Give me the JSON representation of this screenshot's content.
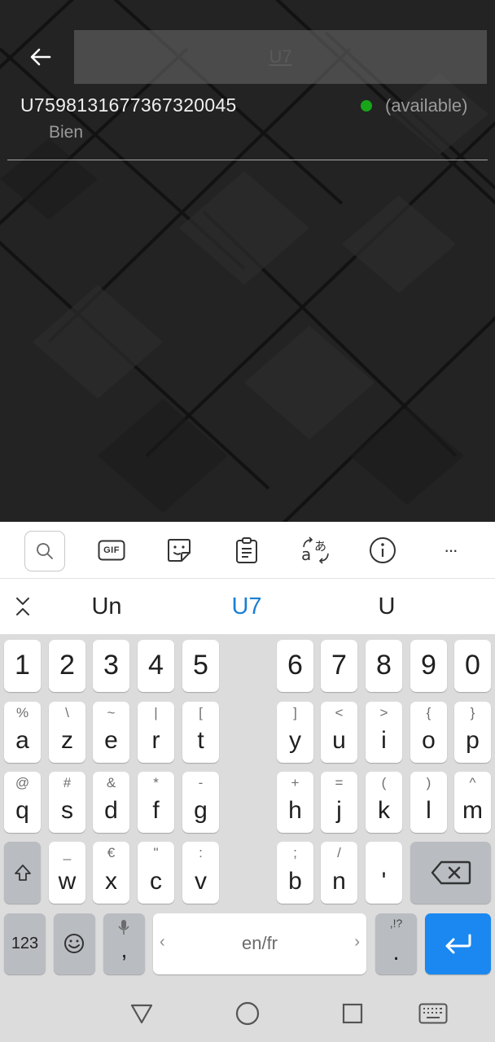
{
  "header": {
    "search_value": "U7"
  },
  "result": {
    "id": "U7598131677367320045",
    "subtitle": "Bien",
    "status": "(available)",
    "status_color": "#18a51a"
  },
  "toolbar": {
    "icons": [
      "search-icon",
      "gif-icon",
      "sticker-icon",
      "clipboard-icon",
      "translate-icon",
      "info-icon",
      "more-icon"
    ],
    "gif_label": "GIF",
    "more_label": "···"
  },
  "suggestions": {
    "items": [
      "Un",
      "U7",
      "U"
    ],
    "highlight_color": "#1a7fd4"
  },
  "keyboard": {
    "numbers": [
      "1",
      "2",
      "3",
      "4",
      "5",
      "6",
      "7",
      "8",
      "9",
      "0"
    ],
    "row1": [
      {
        "main": "a",
        "sub": "%"
      },
      {
        "main": "z",
        "sub": "\\"
      },
      {
        "main": "e",
        "sub": "~"
      },
      {
        "main": "r",
        "sub": "|"
      },
      {
        "main": "t",
        "sub": "["
      },
      {
        "main": "y",
        "sub": "]"
      },
      {
        "main": "u",
        "sub": "<"
      },
      {
        "main": "i",
        "sub": ">"
      },
      {
        "main": "o",
        "sub": "{"
      },
      {
        "main": "p",
        "sub": "}"
      }
    ],
    "row2": [
      {
        "main": "q",
        "sub": "@"
      },
      {
        "main": "s",
        "sub": "#"
      },
      {
        "main": "d",
        "sub": "&"
      },
      {
        "main": "f",
        "sub": "*"
      },
      {
        "main": "g",
        "sub": "-"
      },
      {
        "main": "h",
        "sub": "+"
      },
      {
        "main": "j",
        "sub": "="
      },
      {
        "main": "k",
        "sub": "("
      },
      {
        "main": "l",
        "sub": ")"
      },
      {
        "main": "m",
        "sub": "^"
      }
    ],
    "row3": [
      {
        "main": "w",
        "sub": "_"
      },
      {
        "main": "x",
        "sub": "€"
      },
      {
        "main": "c",
        "sub": "\""
      },
      {
        "main": "v",
        "sub": ":"
      },
      {
        "main": "b",
        "sub": ";"
      },
      {
        "main": "n",
        "sub": "/"
      },
      {
        "main": "'",
        "sub": ""
      }
    ],
    "num_toggle": "123",
    "comma": ",",
    "space_label": "en/fr",
    "period": ".",
    "period_sub": ",!?",
    "enter_color": "#1a88f0"
  }
}
